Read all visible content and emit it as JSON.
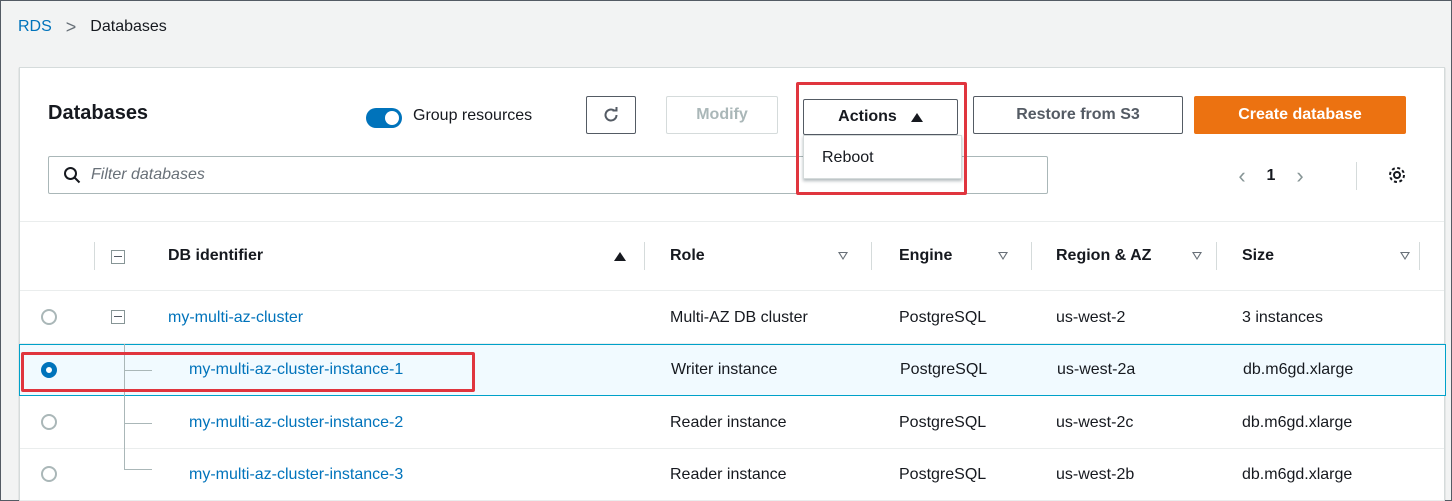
{
  "breadcrumb": {
    "root": "RDS",
    "separator": ">",
    "current": "Databases"
  },
  "header": {
    "title": "Databases",
    "group_resources_label": "Group resources",
    "group_resources_enabled": true,
    "modify_label": "Modify",
    "actions_label": "Actions",
    "restore_label": "Restore from S3",
    "create_label": "Create database"
  },
  "actions_menu": {
    "items": [
      {
        "label": "Reboot"
      }
    ]
  },
  "filter": {
    "placeholder": "Filter databases",
    "value": ""
  },
  "pagination": {
    "page": "1"
  },
  "table": {
    "columns": {
      "identifier": "DB identifier",
      "role": "Role",
      "engine": "Engine",
      "region": "Region & AZ",
      "size": "Size"
    },
    "rows": [
      {
        "identifier": "my-multi-az-cluster",
        "role": "Multi-AZ DB cluster",
        "engine": "PostgreSQL",
        "region": "us-west-2",
        "size": "3 instances",
        "selected": false
      },
      {
        "identifier": "my-multi-az-cluster-instance-1",
        "role": "Writer instance",
        "engine": "PostgreSQL",
        "region": "us-west-2a",
        "size": "db.m6gd.xlarge",
        "selected": true
      },
      {
        "identifier": "my-multi-az-cluster-instance-2",
        "role": "Reader instance",
        "engine": "PostgreSQL",
        "region": "us-west-2c",
        "size": "db.m6gd.xlarge",
        "selected": false
      },
      {
        "identifier": "my-multi-az-cluster-instance-3",
        "role": "Reader instance",
        "engine": "PostgreSQL",
        "region": "us-west-2b",
        "size": "db.m6gd.xlarge",
        "selected": false
      }
    ]
  },
  "colors": {
    "link": "#0073bb",
    "primary_button": "#ec7211",
    "highlight": "#e0353e",
    "selected_row": "#f1faff"
  },
  "icons": [
    "refresh-icon",
    "caret-up-icon",
    "search-icon",
    "chevron-left-icon",
    "chevron-right-icon",
    "gear-icon",
    "sort-ascending-icon",
    "sort-descending-icon",
    "collapse-icon"
  ]
}
